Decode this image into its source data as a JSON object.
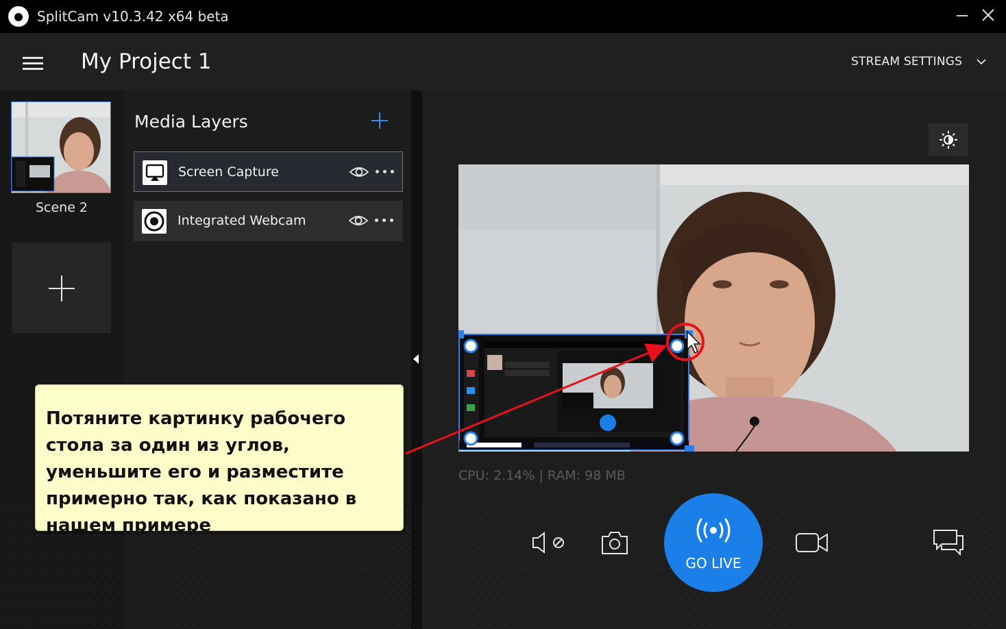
{
  "window": {
    "title": "SplitCam v10.3.42 x64 beta"
  },
  "header": {
    "project_title": "My Project 1",
    "stream_settings_label": "STREAM SETTINGS"
  },
  "scenes": {
    "items": [
      {
        "label": "Scene 2"
      }
    ]
  },
  "layers": {
    "title": "Media Layers",
    "items": [
      {
        "label": "Screen Capture",
        "icon": "screen-capture-icon",
        "selected": true
      },
      {
        "label": "Integrated Webcam",
        "icon": "webcam-icon",
        "selected": false
      }
    ]
  },
  "preview": {
    "stats": "CPU: 2.14% | RAM: 98 MB"
  },
  "controls": {
    "go_live_label": "GO LIVE"
  },
  "callout": {
    "text": "Потяните картинку рабочего стола за один из углов, уменьшите его и разместите примерно так, как показано в нашем примере"
  },
  "colors": {
    "accent": "#1a7fe8",
    "selection": "#2b7fe8",
    "callout_bg": "#fdfdca",
    "annotation": "#e8101a"
  }
}
